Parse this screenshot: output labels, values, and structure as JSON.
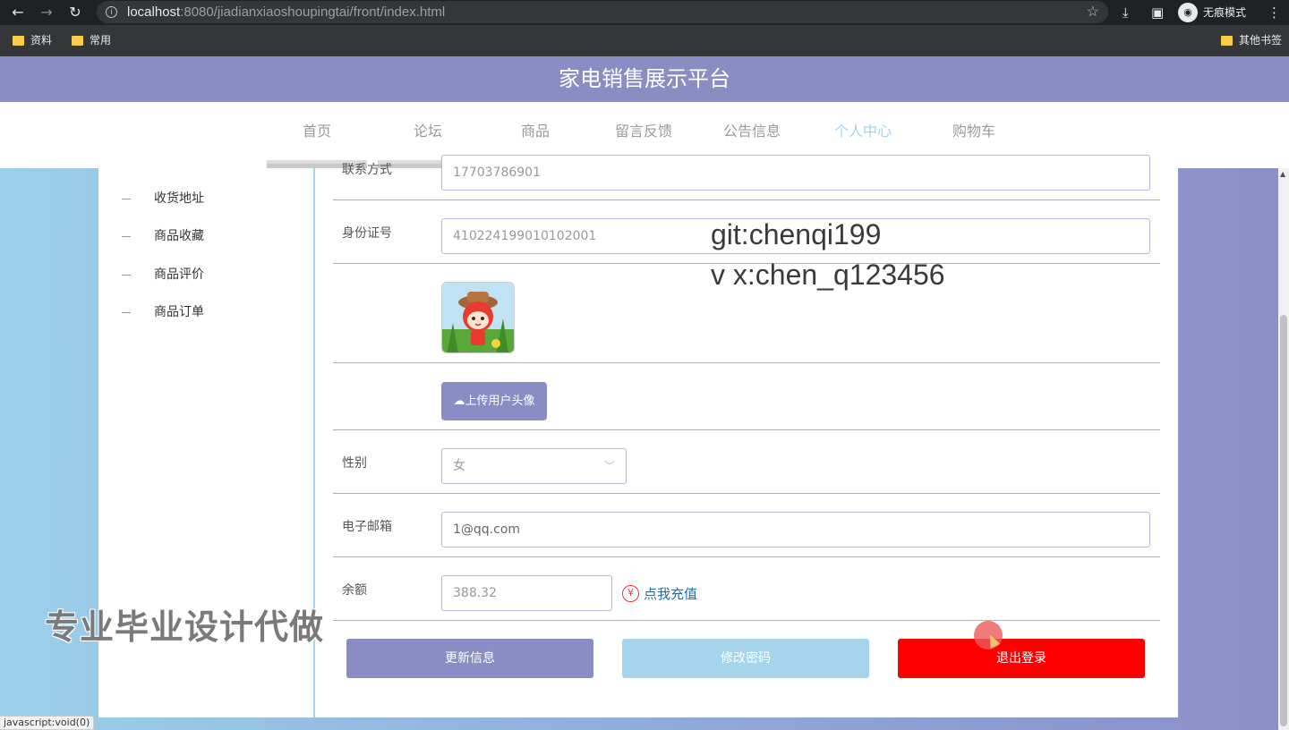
{
  "browser": {
    "url_host": "localhost",
    "url_path": ":8080/jiadianxiaoshoupingtai/front/index.html",
    "incognito_label": "无痕模式",
    "bookmarks": [
      "资料",
      "常用"
    ],
    "other_bookmarks": "其他书签",
    "status_text": "javascript:void(0)"
  },
  "site": {
    "title": "家电销售展示平台",
    "nav": [
      "首页",
      "论坛",
      "商品",
      "留言反馈",
      "公告信息",
      "个人中心",
      "购物车"
    ],
    "active_nav": "个人中心"
  },
  "sidebar": {
    "items": [
      "收货地址",
      "商品收藏",
      "商品评价",
      "商品订单"
    ]
  },
  "form": {
    "contact_label": "联系方式",
    "contact_value": "17703786901",
    "idcard_label": "身份证号",
    "idcard_value": "410224199010102001",
    "upload_label": "上传用户头像",
    "gender_label": "性别",
    "gender_value": "女",
    "email_label": "电子邮箱",
    "email_value": "1@qq.com",
    "balance_label": "余额",
    "balance_value": "388.32",
    "recharge_label": "点我充值",
    "update_button": "更新信息",
    "password_button": "修改密码",
    "logout_button": "退出登录"
  },
  "overlay": {
    "git": "git:chenqi199",
    "wx": "v x:chen_q123456",
    "ad": "专业毕业设计代做"
  },
  "colors": {
    "primary": "#8a8cc4",
    "accent": "#a6d4ec",
    "danger": "#ff0000"
  }
}
